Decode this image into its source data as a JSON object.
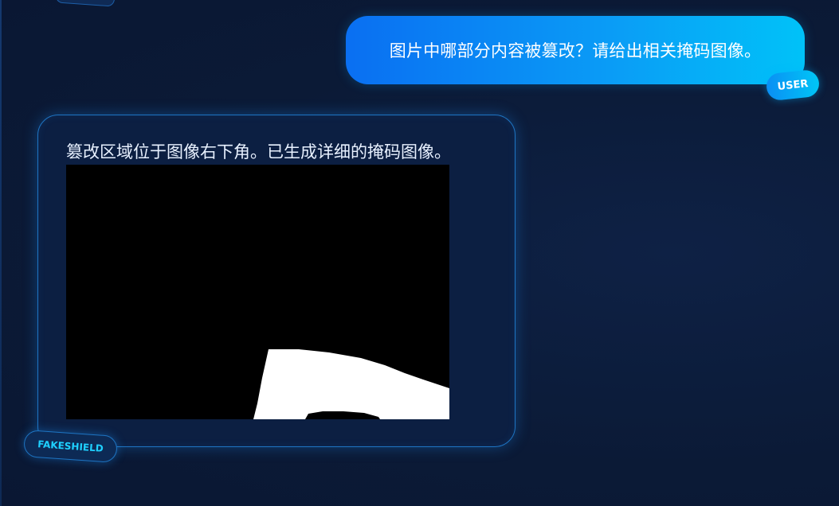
{
  "chat": {
    "user_message": "图片中哪部分内容被篡改？请给出相关掩码图像。",
    "user_badge": "USER",
    "ai_message": "篡改区域位于图像右下角。已生成详细的掩码图像。",
    "ai_badge": "FAKESHIELD"
  },
  "mask_image": {
    "background_color": "#000000",
    "region_color": "#ffffff"
  },
  "colors": {
    "page_background": "#0b1a36",
    "user_bubble_start": "#0a6ff2",
    "user_bubble_end": "#00c2f8",
    "ai_bubble_border": "#1e74c2",
    "ai_badge_text": "#1fd0ff"
  }
}
